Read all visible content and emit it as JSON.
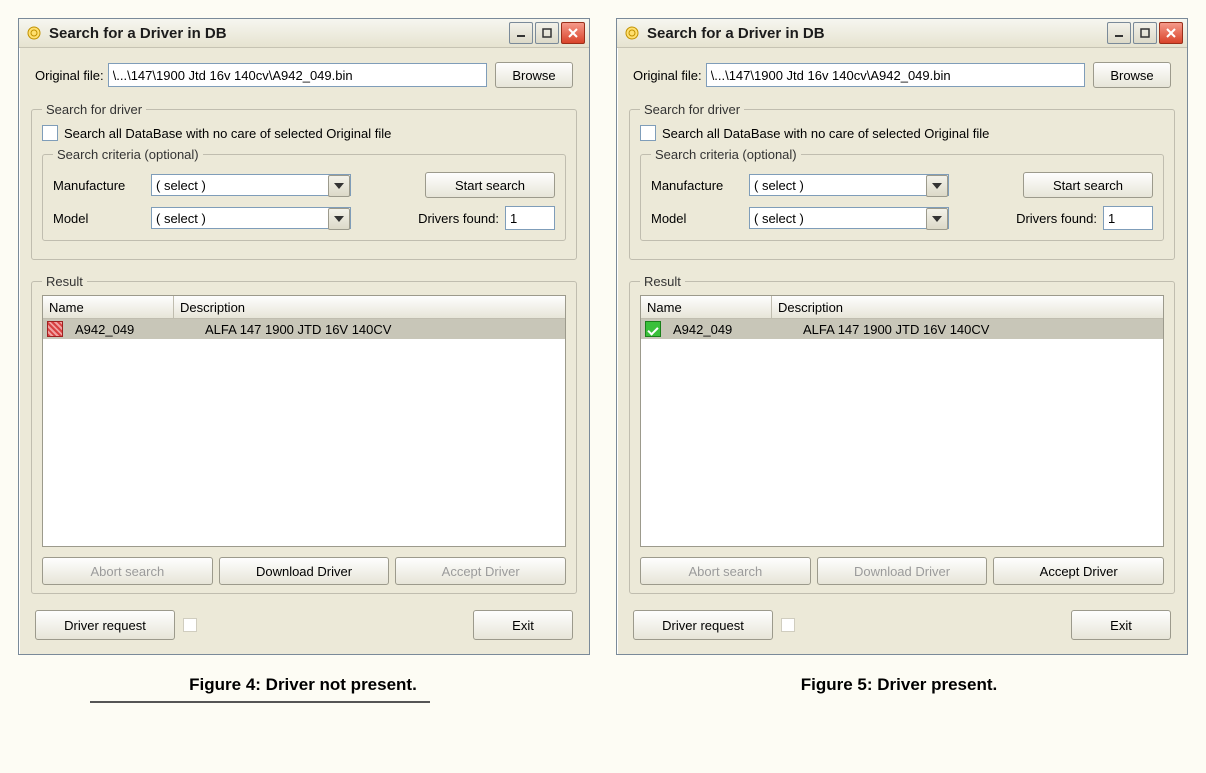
{
  "windows": [
    {
      "title": "Search for a Driver in DB",
      "file_label": "Original file:",
      "file_value": "\\...\\147\\1900 Jtd 16v 140cv\\A942_049.bin",
      "browse_label": "Browse",
      "search_group": "Search for driver",
      "search_all_label": "Search all DataBase with no care of selected Original file",
      "criteria_group": "Search criteria (optional)",
      "manufacture_label": "Manufacture",
      "manufacture_value": "( select )",
      "model_label": "Model",
      "model_value": "( select )",
      "start_search_label": "Start search",
      "drivers_found_label": "Drivers found:",
      "drivers_found_value": "1",
      "result_group": "Result",
      "col_name": "Name",
      "col_desc": "Description",
      "row": {
        "status": "not-present",
        "name": "A942_049",
        "desc": "ALFA 147 1900 JTD 16V 140CV"
      },
      "abort_label": "Abort search",
      "download_label": "Download Driver",
      "accept_label": "Accept Driver",
      "abort_enabled": false,
      "download_enabled": true,
      "accept_enabled": false,
      "request_label": "Driver request",
      "exit_label": "Exit",
      "caption": "Figure 4: Driver not present."
    },
    {
      "title": "Search for a Driver in DB",
      "file_label": "Original file:",
      "file_value": "\\...\\147\\1900 Jtd 16v 140cv\\A942_049.bin",
      "browse_label": "Browse",
      "search_group": "Search for driver",
      "search_all_label": "Search all DataBase with no care of selected Original file",
      "criteria_group": "Search criteria (optional)",
      "manufacture_label": "Manufacture",
      "manufacture_value": "( select )",
      "model_label": "Model",
      "model_value": "( select )",
      "start_search_label": "Start search",
      "drivers_found_label": "Drivers found:",
      "drivers_found_value": "1",
      "result_group": "Result",
      "col_name": "Name",
      "col_desc": "Description",
      "row": {
        "status": "present",
        "name": "A942_049",
        "desc": "ALFA 147 1900 JTD 16V 140CV"
      },
      "abort_label": "Abort search",
      "download_label": "Download Driver",
      "accept_label": "Accept Driver",
      "abort_enabled": false,
      "download_enabled": false,
      "accept_enabled": true,
      "request_label": "Driver request",
      "exit_label": "Exit",
      "caption": "Figure 5: Driver present."
    }
  ]
}
